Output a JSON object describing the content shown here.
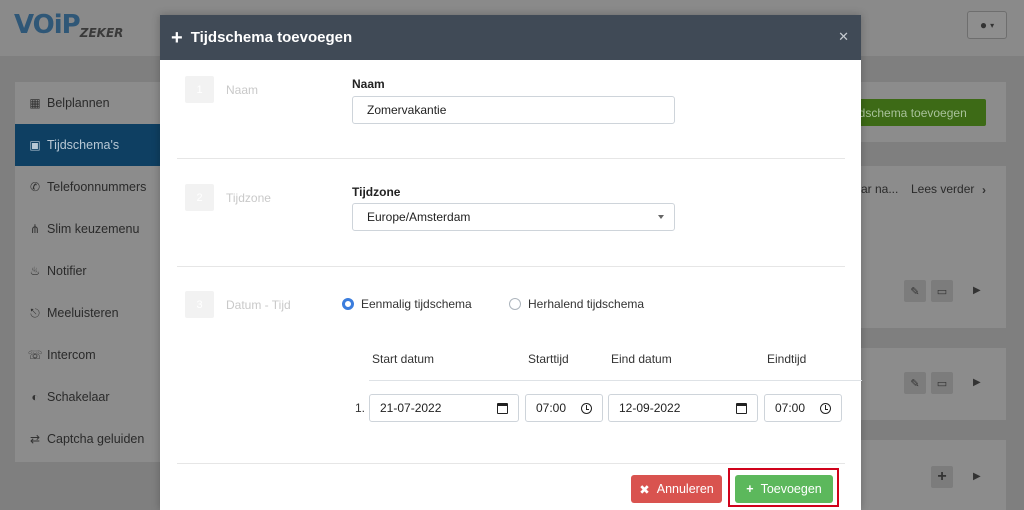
{
  "app": {
    "logo_main": "VOiP",
    "logo_sub": "ZEKER"
  },
  "sidebar": {
    "items": [
      {
        "label": "Belplannen",
        "icon": "sitemap-icon"
      },
      {
        "label": "Tijdschema's",
        "icon": "calendar-icon",
        "active": true
      },
      {
        "label": "Telefoonnummers",
        "icon": "phone-icon"
      },
      {
        "label": "Slim keuzemenu",
        "icon": "branch-icon"
      },
      {
        "label": "Notifier",
        "icon": "bell-icon"
      },
      {
        "label": "Meeluisteren",
        "icon": "headphones-icon"
      },
      {
        "label": "Intercom",
        "icon": "phone-slash-icon"
      },
      {
        "label": "Schakelaar",
        "icon": "toggle-icon"
      },
      {
        "label": "Captcha geluiden",
        "icon": "shuffle-icon"
      }
    ]
  },
  "background": {
    "add_button": "jdschema toevoegen",
    "col_partial": "ar na...",
    "read_more": "Lees verder"
  },
  "modal": {
    "title": "Tijdschema toevoegen",
    "steps": [
      {
        "number": "1",
        "label": "Naam"
      },
      {
        "number": "2",
        "label": "Tijdzone"
      },
      {
        "number": "3",
        "label": "Datum - Tijd"
      }
    ],
    "name": {
      "label": "Naam",
      "value": "Zomervakantie"
    },
    "timezone": {
      "label": "Tijdzone",
      "value": "Europe/Amsterdam"
    },
    "schedule_type": {
      "options": [
        "Eenmalig tijdschema",
        "Herhalend tijdschema"
      ],
      "selected": "Eenmalig tijdschema"
    },
    "table": {
      "headers": [
        "Start datum",
        "Starttijd",
        "Eind datum",
        "Eindtijd"
      ],
      "rows": [
        {
          "index": "1.",
          "start_date": "21-07-2022",
          "start_time": "07:00",
          "end_date": "12-09-2022",
          "end_time": "07:00"
        }
      ]
    },
    "buttons": {
      "cancel": "Annuleren",
      "add": "Toevoegen"
    }
  },
  "colors": {
    "header": "#404a56",
    "primary": "#3b7ddd",
    "danger": "#d9534f",
    "success": "#5cb85c",
    "highlight": "#d0021b"
  }
}
